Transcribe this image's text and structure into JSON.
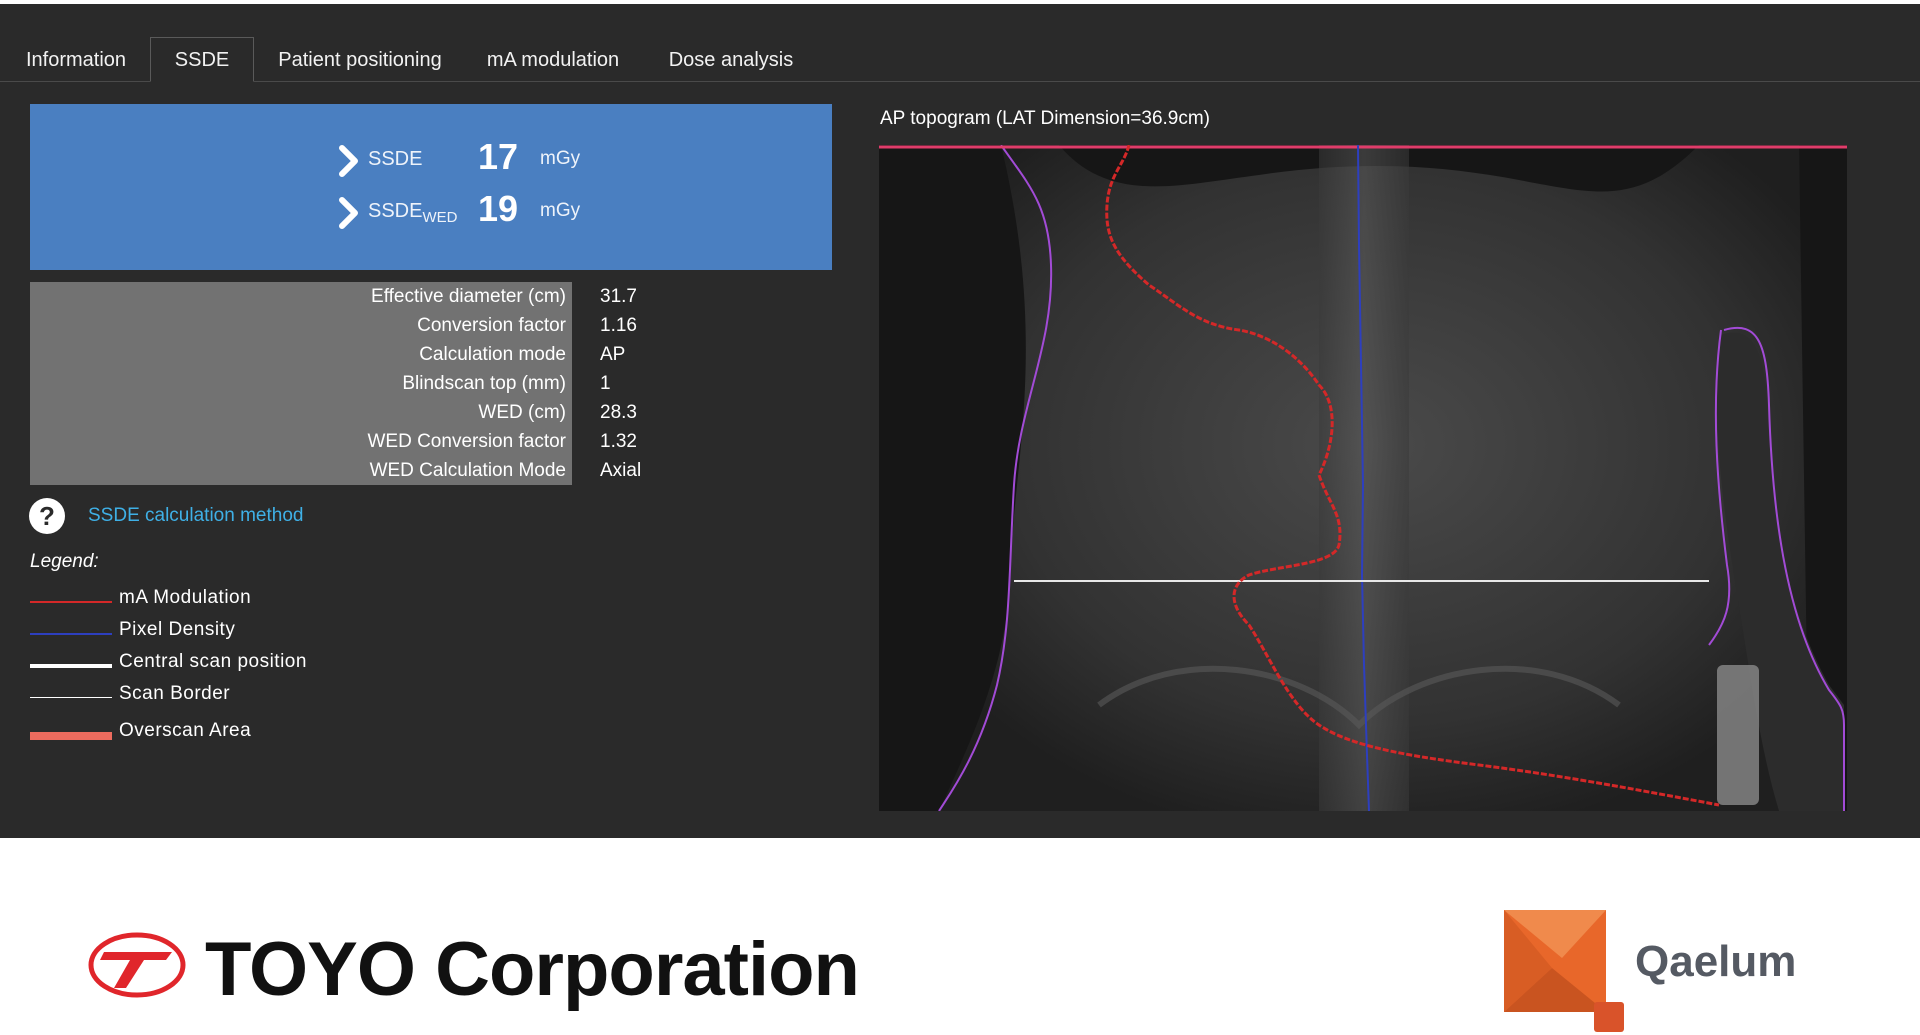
{
  "tabs": [
    {
      "label": "Information",
      "active": false
    },
    {
      "label": "SSDE",
      "active": true
    },
    {
      "label": "Patient positioning",
      "active": false
    },
    {
      "label": "mA modulation",
      "active": false
    },
    {
      "label": "Dose analysis",
      "active": false
    }
  ],
  "ssde": {
    "rows": [
      {
        "label": "SSDE",
        "subscript": "",
        "value": "17",
        "unit": "mGy"
      },
      {
        "label": "SSDE",
        "subscript": "WED",
        "value": "19",
        "unit": "mGy"
      }
    ]
  },
  "info": [
    {
      "label": "Effective diameter (cm)",
      "value": "31.7"
    },
    {
      "label": "Conversion factor",
      "value": "1.16"
    },
    {
      "label": "Calculation mode",
      "value": "AP"
    },
    {
      "label": "Blindscan top (mm)",
      "value": "1"
    },
    {
      "label": "WED (cm)",
      "value": "28.3"
    },
    {
      "label": "WED Conversion factor",
      "value": "1.32"
    },
    {
      "label": "WED Calculation Mode",
      "value": "Axial"
    }
  ],
  "help": {
    "icon": "question-circle-icon",
    "link_text": "SSDE calculation method"
  },
  "legend": {
    "title": "Legend:",
    "items": [
      {
        "label": "mA Modulation",
        "color": "#d42828"
      },
      {
        "label": "Pixel Density",
        "color": "#2d3fbf"
      },
      {
        "label": "Central scan position",
        "color": "#ffffff"
      },
      {
        "label": "Scan Border",
        "color": "#ffffff"
      },
      {
        "label": "Overscan Area",
        "color": "#ec6b5e"
      }
    ]
  },
  "topogram": {
    "title": "AP topogram (LAT Dimension=36.9cm)"
  },
  "footer": {
    "toyo": "TOYO Corporation",
    "qaelum": "Qaelum"
  },
  "colors": {
    "background": "#2a2a2a",
    "ssde_panel": "#4a7fc1",
    "info_label_bg": "#727272",
    "link": "#3fb0e6",
    "body_outline": "#a24bd6",
    "toyo_red": "#e0262b",
    "qaelum_orange": "#e8672a"
  }
}
